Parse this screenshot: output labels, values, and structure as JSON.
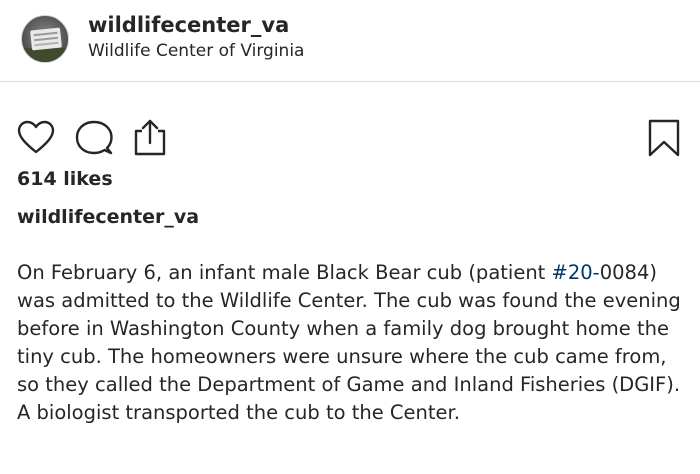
{
  "post": {
    "username": "wildlifecenter_va",
    "location": "Wildlife Center of Virginia",
    "likes": "614 likes",
    "caption_username": "wildlifecenter_va",
    "caption_before": "On February 6, an infant male Black Bear cub (patient ",
    "caption_hashtag": "#20-",
    "caption_after": "0084) was admitted to the Wildlife Center. The cub was found the evening before in Washington County when a family dog brought home the tiny cub. The homeowners were unsure where the cub came from, so they called the Department of Game and Inland Fisheries (DGIF). A biologist transported the cub to the Center."
  },
  "icons": {
    "like": "heart-icon",
    "comment": "comment-icon",
    "share": "share-icon",
    "save": "bookmark-icon"
  },
  "colors": {
    "text": "#262626",
    "hashtag": "#00376b",
    "divider": "#dbdbdb"
  }
}
